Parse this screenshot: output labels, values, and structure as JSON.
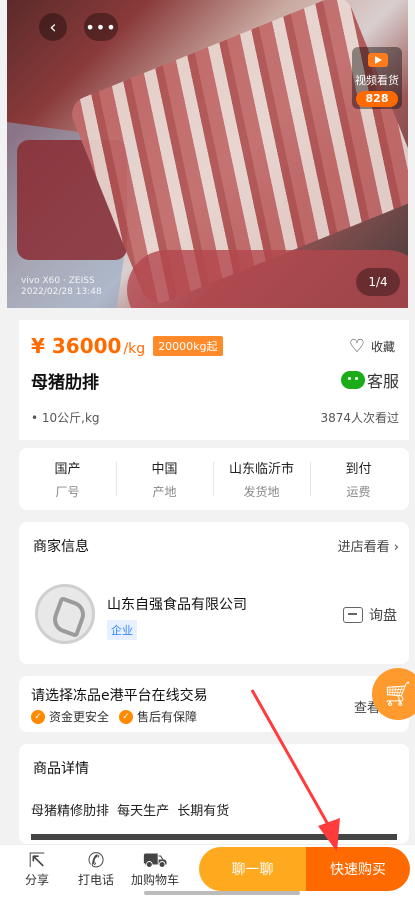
{
  "hero": {
    "video_label": "视频看货",
    "video_count": "828",
    "page_indicator": "1/4",
    "watermark_line1": "vivo X60 · ZEISS",
    "watermark_line2": "2022/02/28 13:48"
  },
  "product": {
    "price": "¥ 36000",
    "price_unit": "/kg",
    "min_order": "20000kg起",
    "favorite_label": "收藏",
    "title": "母猪肋排",
    "service_label": "客服",
    "spec": "• 10公斤,kg",
    "views": "3874人次看过"
  },
  "info": [
    {
      "value": "国产",
      "key": "厂号"
    },
    {
      "value": "中国",
      "key": "产地"
    },
    {
      "value": "山东临沂市",
      "key": "发货地"
    },
    {
      "value": "到付",
      "key": "运费"
    }
  ],
  "merchant": {
    "header": "商家信息",
    "visit_label": "进店看看",
    "name": "山东自强食品有限公司",
    "tag": "企业",
    "inquire_label": "询盘"
  },
  "trade": {
    "title": "请选择冻品e港平台在线交易",
    "item1": "资金更安全",
    "item2": "售后有保障",
    "see_more": "查看详"
  },
  "details": {
    "header": "商品详情",
    "text": "母猪精修肋排 每天生产 长期有货"
  },
  "bottom_bar": {
    "share": "分享",
    "call": "打电话",
    "cart": "加购物车",
    "chat": "聊一聊",
    "buy": "快速购买"
  },
  "colors": {
    "accent": "#ff6a00",
    "chat_button": "#ffa91f",
    "annotation_arrow": "#ff3b3b"
  }
}
